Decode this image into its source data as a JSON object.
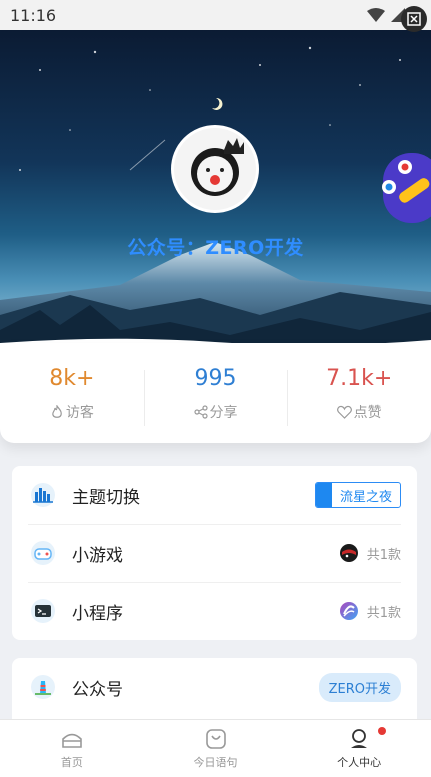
{
  "status_bar": {
    "time": "11:16"
  },
  "profile": {
    "title": "公众号：ZERO开发"
  },
  "stats": [
    {
      "value": "8k+",
      "label": "访客",
      "color": "#e0892f",
      "icon": "fire-icon"
    },
    {
      "value": "995",
      "label": "分享",
      "color": "#2f7fd3",
      "icon": "share-icon"
    },
    {
      "value": "7.1k+",
      "label": "点赞",
      "color": "#d9534f",
      "icon": "heart-icon"
    }
  ],
  "menu": {
    "theme": {
      "label": "主题切换",
      "value": "流星之夜"
    },
    "game": {
      "label": "小游戏",
      "count": "共1款"
    },
    "miniapp": {
      "label": "小程序",
      "count": "共1款"
    },
    "official": {
      "label": "公众号",
      "value": "ZERO开发"
    }
  },
  "tabs": [
    {
      "label": "首页",
      "icon": "home-icon"
    },
    {
      "label": "今日语句",
      "icon": "bag-icon"
    },
    {
      "label": "个人中心",
      "icon": "user-icon",
      "active": true
    }
  ]
}
